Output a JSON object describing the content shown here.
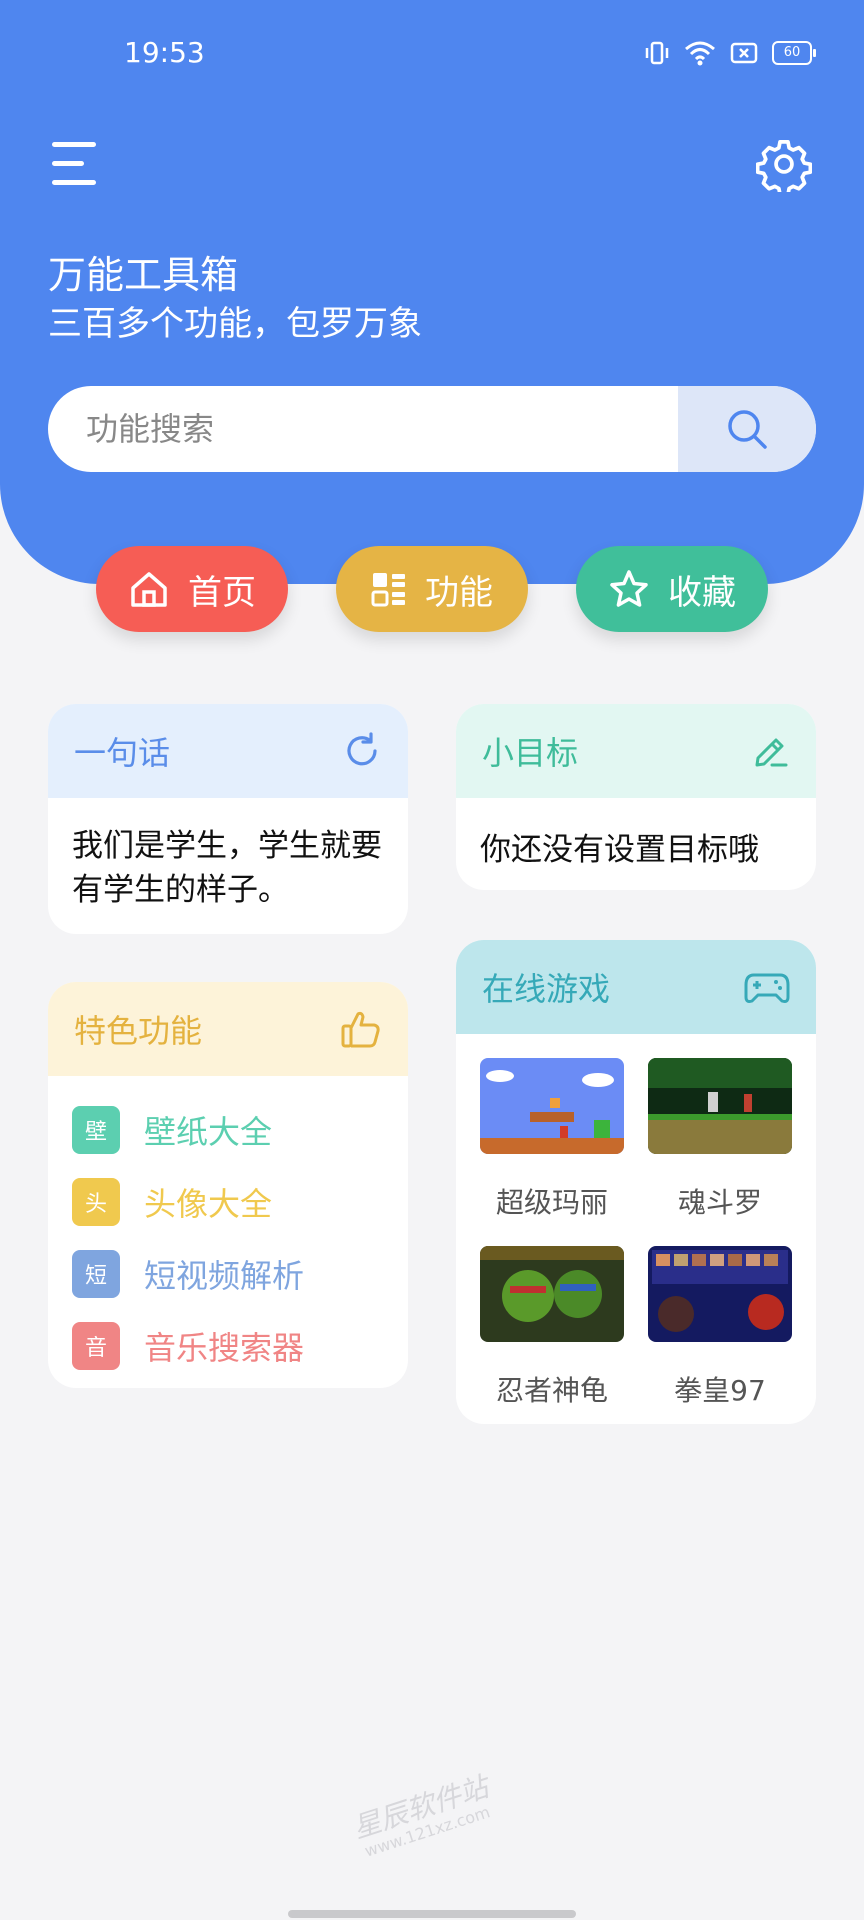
{
  "status": {
    "time": "19:53",
    "battery": "60"
  },
  "header": {
    "title": "万能工具箱",
    "subtitle": "三百多个功能，包罗万象",
    "search_placeholder": "功能搜索"
  },
  "nav": [
    {
      "label": "首页",
      "icon": "home-icon",
      "color": "#f65d55"
    },
    {
      "label": "功能",
      "icon": "grid-icon",
      "color": "#e5b445"
    },
    {
      "label": "收藏",
      "icon": "star-icon",
      "color": "#40bf9a"
    }
  ],
  "quote": {
    "title": "一句话",
    "text": "我们是学生，学生就要有学生的样子。"
  },
  "goal": {
    "title": "小目标",
    "text": "你还没有设置目标哦"
  },
  "features": {
    "title": "特色功能",
    "items": [
      {
        "badge": "壁",
        "label": "壁纸大全",
        "color": "#5ccfb0"
      },
      {
        "badge": "头",
        "label": "头像大全",
        "color": "#f0c94e"
      },
      {
        "badge": "短",
        "label": "短视频解析",
        "color": "#7fa5df"
      },
      {
        "badge": "音",
        "label": "音乐搜索器",
        "color": "#f08585"
      }
    ]
  },
  "games": {
    "title": "在线游戏",
    "items": [
      {
        "label": "超级玛丽"
      },
      {
        "label": "魂斗罗"
      },
      {
        "label": "忍者神龟"
      },
      {
        "label": "拳皇97"
      }
    ]
  },
  "watermark": {
    "line1": "星辰软件站",
    "line2": "www.121xz.com"
  }
}
